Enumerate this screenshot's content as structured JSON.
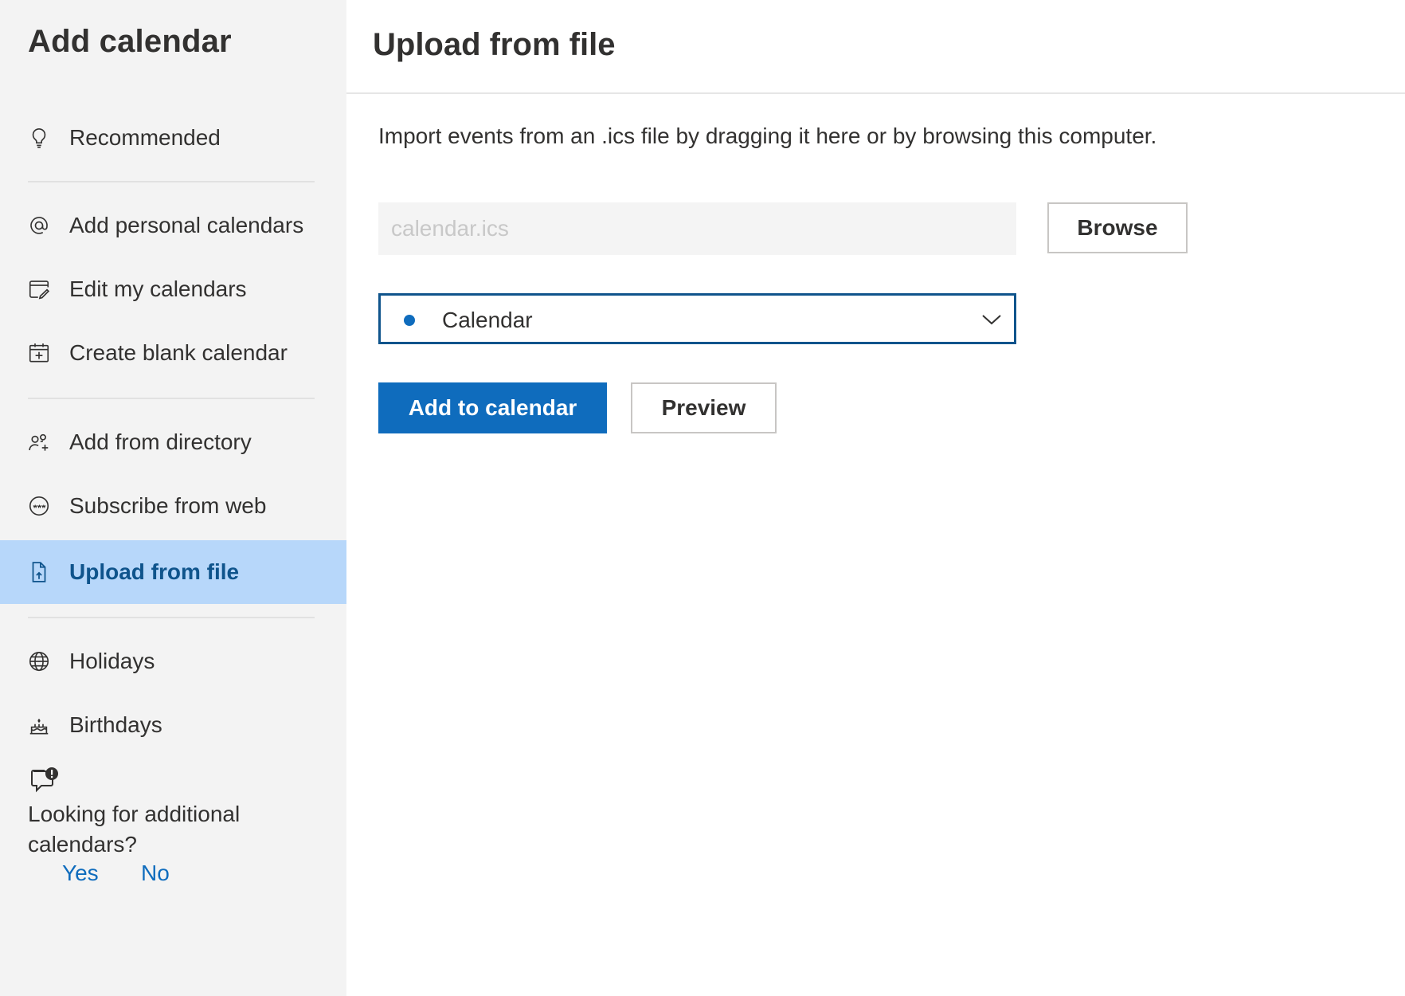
{
  "sidebar": {
    "title": "Add calendar",
    "items": [
      {
        "label": "Recommended",
        "icon": "lightbulb-icon"
      },
      {
        "label": "Add personal calendars",
        "icon": "at-sign-icon"
      },
      {
        "label": "Edit my calendars",
        "icon": "edit-calendar-icon"
      },
      {
        "label": "Create blank calendar",
        "icon": "calendar-add-icon"
      },
      {
        "label": "Add from directory",
        "icon": "people-add-icon"
      },
      {
        "label": "Subscribe from web",
        "icon": "web-icon"
      },
      {
        "label": "Upload from file",
        "icon": "document-upload-icon",
        "active": true
      },
      {
        "label": "Holidays",
        "icon": "globe-icon"
      },
      {
        "label": "Birthdays",
        "icon": "cake-icon"
      }
    ],
    "feedback": {
      "icon": "feedback-alert-icon",
      "question": "Looking for additional calendars?",
      "yes_label": "Yes",
      "no_label": "No"
    }
  },
  "main": {
    "title": "Upload from file",
    "description": "Import events from an .ics file by dragging it here or by browsing this computer.",
    "file_input": {
      "placeholder": "calendar.ics",
      "value": ""
    },
    "browse_label": "Browse",
    "calendar_select": {
      "selected": "Calendar",
      "dot_color": "#0f6cbd"
    },
    "add_label": "Add to calendar",
    "preview_label": "Preview"
  },
  "colors": {
    "accent": "#0f6cbd",
    "active_bg": "#b7d7fa",
    "active_text": "#0f548c",
    "sidebar_bg": "#f3f3f3"
  }
}
